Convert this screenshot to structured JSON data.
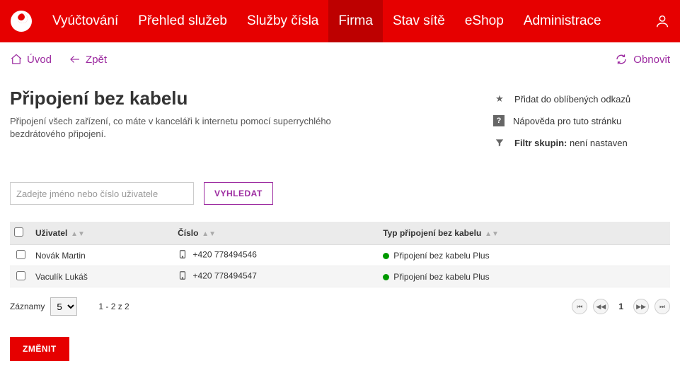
{
  "nav": {
    "items": [
      {
        "label": "Vyúčtování",
        "active": false
      },
      {
        "label": "Přehled služeb",
        "active": false
      },
      {
        "label": "Služby čísla",
        "active": false
      },
      {
        "label": "Firma",
        "active": true
      },
      {
        "label": "Stav sítě",
        "active": false
      },
      {
        "label": "eShop",
        "active": false
      },
      {
        "label": "Administrace",
        "active": false
      }
    ]
  },
  "utilbar": {
    "home": "Úvod",
    "back": "Zpět",
    "refresh": "Obnovit"
  },
  "page": {
    "title": "Připojení bez kabelu",
    "description": "Připojení všech zařízení, co máte v kanceláři k internetu pomocí superrychlého bezdrátového připojení."
  },
  "side_links": {
    "favorite": "Přidat do oblíbených odkazů",
    "help": "Nápověda pro tuto stránku",
    "filter_label": "Filtr skupin:",
    "filter_value": "není nastaven"
  },
  "search": {
    "placeholder": "Zadejte jméno nebo číslo uživatele",
    "button": "VYHLEDAT"
  },
  "table": {
    "headers": {
      "user": "Uživatel",
      "number": "Číslo",
      "type": "Typ připojení bez kabelu"
    },
    "rows": [
      {
        "user": "Novák Martin",
        "number": "+420 778494546",
        "type": "Připojení bez kabelu Plus"
      },
      {
        "user": "Vaculík Lukáš",
        "number": "+420 778494547",
        "type": "Připojení bez kabelu Plus"
      }
    ]
  },
  "paging": {
    "records_label": "Záznamy",
    "page_size": "5",
    "range": "1 - 2 z 2",
    "current": "1"
  },
  "actions": {
    "change": "ZMĚNIT"
  }
}
